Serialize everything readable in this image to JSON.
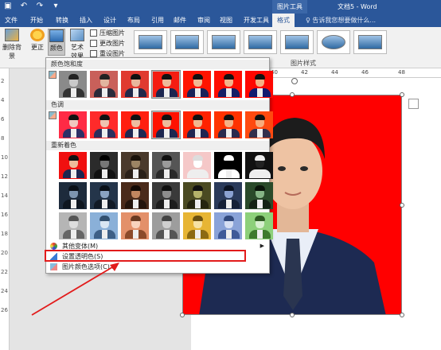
{
  "titlebar": {
    "context_tab_group": "图片工具",
    "document_title": "文档5 - Word"
  },
  "tabs": [
    {
      "label": "文件"
    },
    {
      "label": "开始"
    },
    {
      "label": "转换"
    },
    {
      "label": "插入"
    },
    {
      "label": "设计"
    },
    {
      "label": "布局"
    },
    {
      "label": "引用"
    },
    {
      "label": "邮件"
    },
    {
      "label": "审阅"
    },
    {
      "label": "视图"
    },
    {
      "label": "开发工具"
    },
    {
      "label": "格式"
    }
  ],
  "tell_me": "♀ 告诉我您想要做什么...",
  "ribbon": {
    "remove_bg": "删除背景",
    "corrections": "更正",
    "color": "颜色",
    "artistic": "艺术效果",
    "compress": "压缩图片",
    "change": "更改图片",
    "reset": "重设图片",
    "styles_label": "图片样式"
  },
  "gallery": {
    "sat_title": "颜色饱和度",
    "tone_title": "色调",
    "recolor_title": "重新着色",
    "more_variations": "其他变体(M)",
    "set_transparent": "设置透明色(S)",
    "color_options": "图片颜色选项(C)..."
  },
  "rulers": {
    "h_ticks": [
      "40",
      "42",
      "44",
      "46",
      "48"
    ],
    "v_ticks": [
      "2",
      "4",
      "6",
      "8",
      "10",
      "12",
      "14",
      "16",
      "18",
      "20",
      "22",
      "24",
      "26"
    ]
  },
  "colors": {
    "accent": "#2b579a",
    "photo_bg": "#ff0000",
    "highlight": "#e21b1b"
  }
}
